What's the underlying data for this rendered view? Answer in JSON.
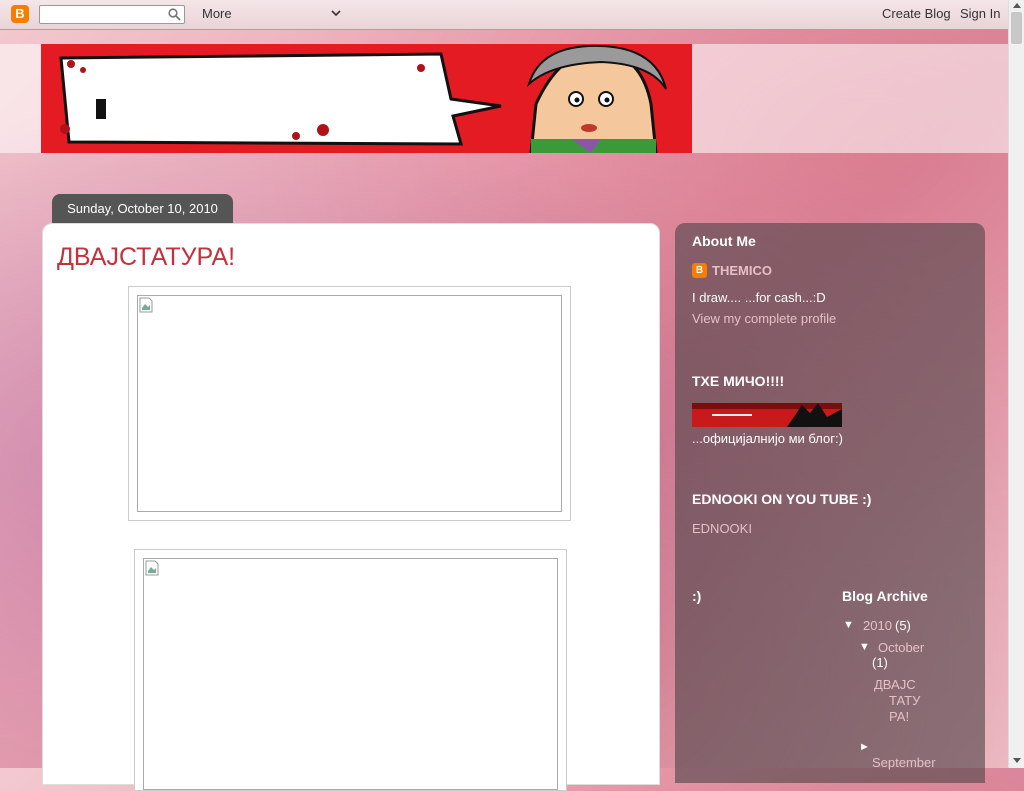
{
  "navbar": {
    "search_placeholder": "",
    "more_label": "More",
    "create_blog_label": "Create Blog",
    "sign_in_label": "Sign In",
    "logo_letter": "B"
  },
  "post": {
    "date": "Sunday, October 10, 2010",
    "title": "ДВАЈСТАТУРА!"
  },
  "sidebar": {
    "about": {
      "heading": "About Me",
      "name": "THEMICO",
      "bio": "I draw.... ...for cash...:D",
      "profile_link": "View my complete profile"
    },
    "ticho": {
      "heading": "ТХЕ МИЧО!!!!",
      "caption": "...официјалнијо ми блог:)"
    },
    "youtube": {
      "heading": "EDNOOKI ON YOU TUBE :)",
      "link": "EDNOOKI"
    },
    "smiley": {
      "heading": ":)"
    },
    "archive": {
      "heading": "Blog Archive",
      "year": {
        "label": "2010",
        "count": "(5)",
        "toggle": "▼"
      },
      "month": {
        "label": "October",
        "count": "(1)",
        "toggle": "▼"
      },
      "post_link": [
        "ДВАЈС",
        "ТАТУ",
        "РА!"
      ],
      "next_month": {
        "label": "September",
        "toggle": "►"
      }
    }
  },
  "colors": {
    "accent_red": "#e41b23",
    "post_title": "#c3323c",
    "sidebar_link": "#e6c0c6"
  }
}
